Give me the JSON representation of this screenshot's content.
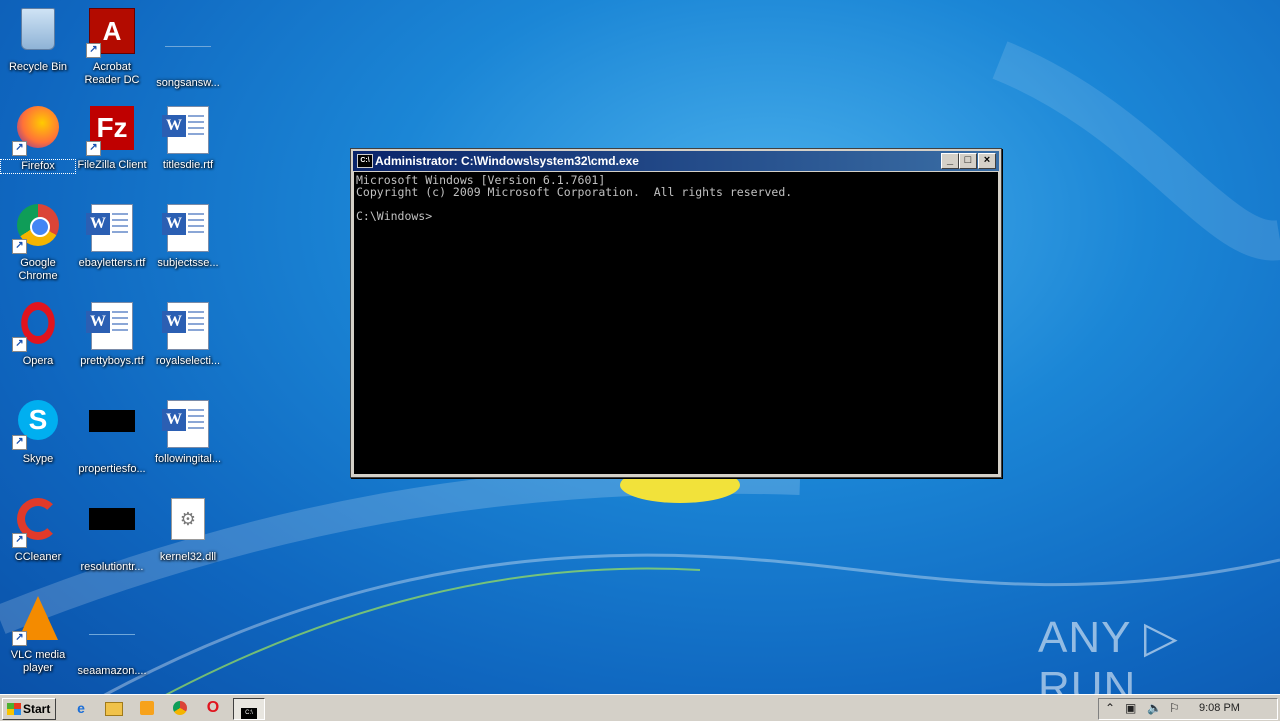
{
  "desktop": {
    "icons": [
      {
        "id": "recycle-bin",
        "label": "Recycle Bin",
        "icon": "recycle-bin-icon",
        "shortcut": false
      },
      {
        "id": "acrobat",
        "label": "Acrobat Reader DC",
        "icon": "acrobat-icon",
        "shortcut": true
      },
      {
        "id": "songsansw",
        "label": "songsansw...",
        "icon": "blank-file-icon",
        "shortcut": false
      },
      {
        "id": "firefox",
        "label": "Firefox",
        "icon": "firefox-icon",
        "shortcut": true
      },
      {
        "id": "filezilla",
        "label": "FileZilla Client",
        "icon": "filezilla-icon",
        "shortcut": true
      },
      {
        "id": "titlesdie",
        "label": "titlesdie.rtf",
        "icon": "word-doc-icon",
        "shortcut": false
      },
      {
        "id": "chrome",
        "label": "Google Chrome",
        "icon": "chrome-icon",
        "shortcut": true
      },
      {
        "id": "ebayletters",
        "label": "ebayletters.rtf",
        "icon": "word-doc-icon",
        "shortcut": false
      },
      {
        "id": "subjectsse",
        "label": "subjectsse...",
        "icon": "word-doc-icon",
        "shortcut": false
      },
      {
        "id": "opera",
        "label": "Opera",
        "icon": "opera-icon",
        "shortcut": true
      },
      {
        "id": "prettyboys",
        "label": "prettyboys.rtf",
        "icon": "word-doc-icon",
        "shortcut": false
      },
      {
        "id": "royalselecti",
        "label": "royalselecti...",
        "icon": "word-doc-icon",
        "shortcut": false
      },
      {
        "id": "skype",
        "label": "Skype",
        "icon": "skype-icon",
        "shortcut": true
      },
      {
        "id": "propertiesfo",
        "label": "propertiesfo...",
        "icon": "black-file-icon",
        "shortcut": false
      },
      {
        "id": "followingital",
        "label": "followingital...",
        "icon": "word-doc-icon",
        "shortcut": false
      },
      {
        "id": "ccleaner",
        "label": "CCleaner",
        "icon": "ccleaner-icon",
        "shortcut": true
      },
      {
        "id": "resolutiontr",
        "label": "resolutiontr...",
        "icon": "black-file-icon",
        "shortcut": false
      },
      {
        "id": "kernel32",
        "label": "kernel32.dll",
        "icon": "dll-icon",
        "shortcut": false
      },
      {
        "id": "vlc",
        "label": "VLC media player",
        "icon": "vlc-icon",
        "shortcut": true
      },
      {
        "id": "seaamazon",
        "label": "seaamazon....",
        "icon": "blank-file-icon",
        "shortcut": false
      }
    ]
  },
  "cmd_window": {
    "title": "Administrator: C:\\Windows\\system32\\cmd.exe",
    "console_text": "Microsoft Windows [Version 6.1.7601]\nCopyright (c) 2009 Microsoft Corporation.  All rights reserved.\n\nC:\\Windows>",
    "buttons": {
      "minimize": "_",
      "maximize": "□",
      "close": "×"
    }
  },
  "taskbar": {
    "start_label": "Start",
    "clock": "9:08 PM",
    "quicklaunch": [
      "ie-icon",
      "explorer-icon",
      "media-player-icon",
      "chrome-icon",
      "opera-icon",
      "cmd-icon"
    ]
  },
  "watermark": "ANY ▷ RUN"
}
